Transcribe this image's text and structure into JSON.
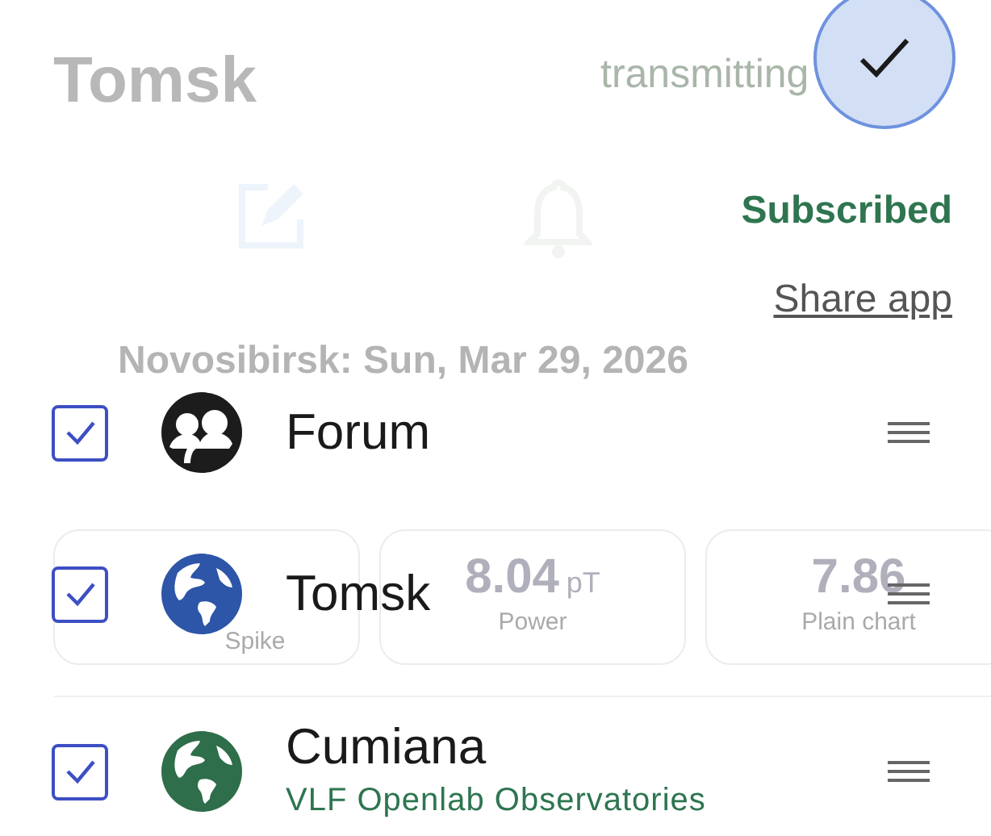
{
  "background": {
    "title": "Tomsk",
    "status": "transmitting",
    "date": "Novosibirsk: Sun, Mar 29, 2026",
    "cards": [
      {
        "label": "Spike"
      },
      {
        "value": "8.04",
        "unit": "pT",
        "label": "Power"
      },
      {
        "value": "7.86",
        "label": "Plain chart"
      }
    ]
  },
  "subscription_status": "Subscribed",
  "share_link": "Share app",
  "items": [
    {
      "name": "Forum",
      "checked": true,
      "kind": "forum",
      "color": "#1c1c1c"
    },
    {
      "name": "Tomsk",
      "checked": true,
      "kind": "station",
      "color": "#2d55a8"
    },
    {
      "name": "Cumiana",
      "subtitle": "VLF Openlab Observatories",
      "checked": true,
      "kind": "station",
      "color": "#2e6e4a"
    }
  ]
}
